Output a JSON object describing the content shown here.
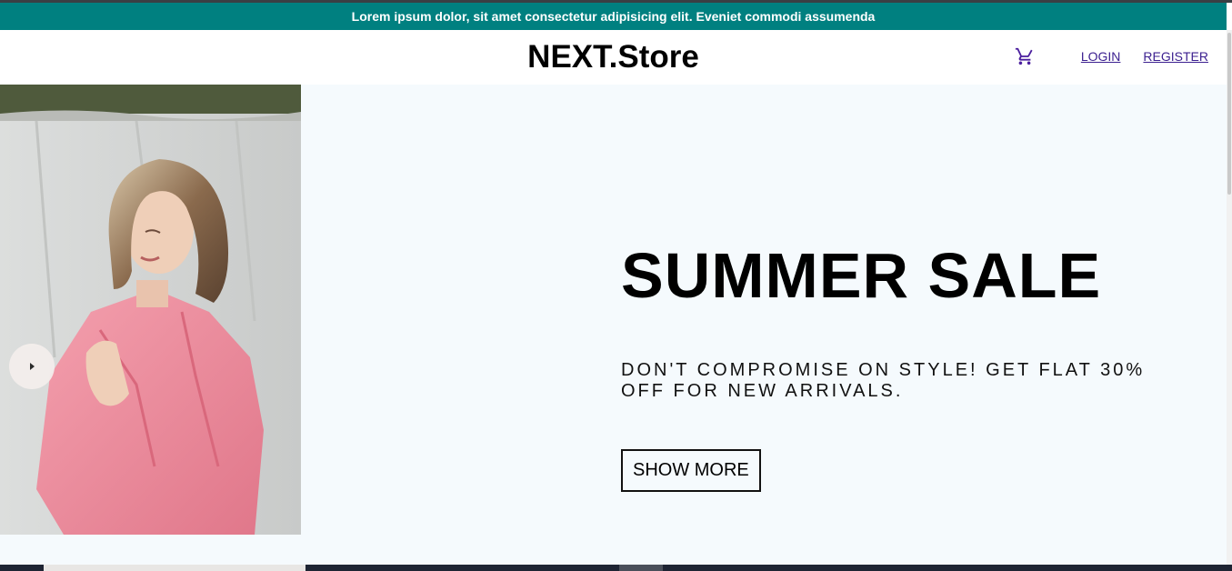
{
  "announcement": {
    "text": "Lorem ipsum dolor, sit amet consectetur adipisicing elit. Eveniet commodi assumenda"
  },
  "navbar": {
    "logo": "NEXT.Store",
    "cart_icon": "shopping-cart-icon",
    "login_label": "LOGIN",
    "register_label": "REGISTER"
  },
  "slider": {
    "prev_arrow_icon": "arrow-left-icon",
    "slide": {
      "title": "SUMMER SALE",
      "description": "DON'T COMPROMISE ON STYLE! GET FLAT 30% OFF FOR NEW ARRIVALS.",
      "button_label": "SHOW MORE"
    }
  },
  "colors": {
    "announcement_bg": "#008080",
    "slide_bg": "#f5fafd",
    "link": "#3b1f8f",
    "cart_icon": "#4b1f9e"
  }
}
